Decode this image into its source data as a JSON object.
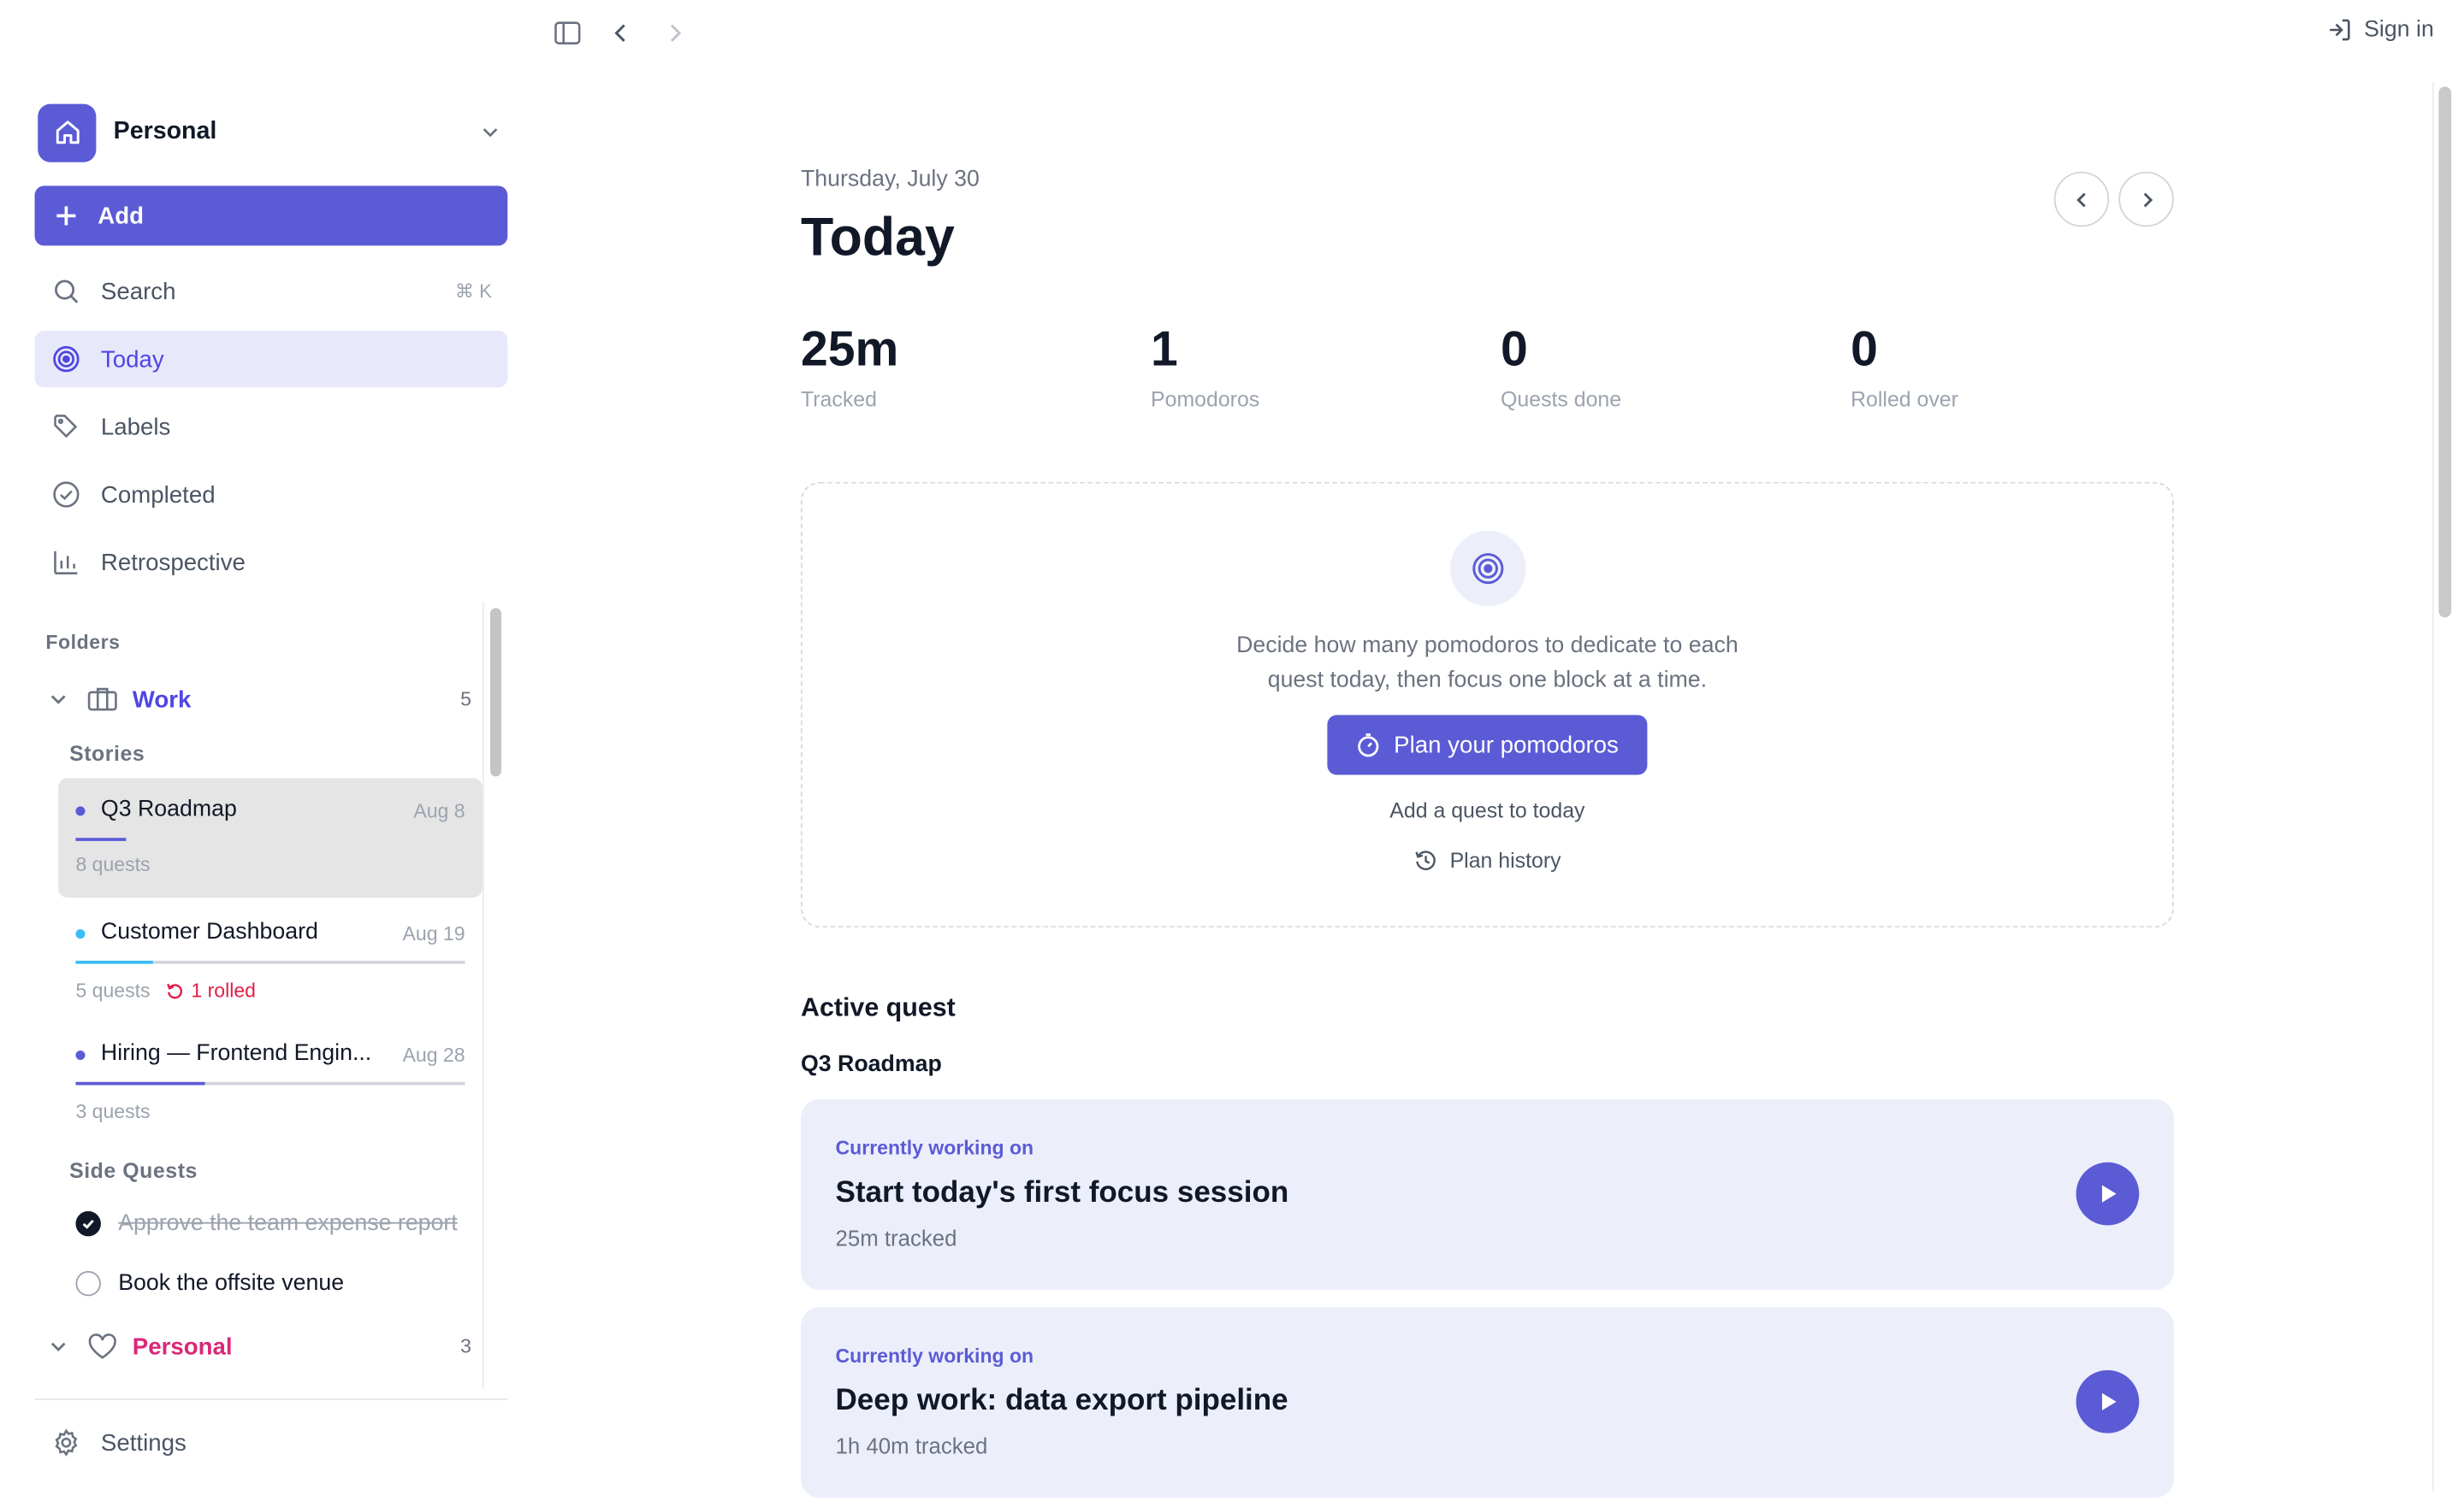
{
  "app": {
    "sign_in_label": "Sign in"
  },
  "colors": {
    "accent": "#5b5bd6",
    "work_folder": "#4f46e5",
    "personal_folder": "#db2777",
    "rolled": "#e11d48"
  },
  "sidebar": {
    "workspace": {
      "name": "Personal",
      "icon": "home-icon"
    },
    "add_label": "Add",
    "nav": [
      {
        "label": "Search",
        "icon": "search-icon",
        "shortcut": "⌘ K"
      },
      {
        "label": "Today",
        "icon": "target-icon",
        "active": true
      },
      {
        "label": "Labels",
        "icon": "tag-icon"
      },
      {
        "label": "Completed",
        "icon": "check-circle-icon"
      },
      {
        "label": "Retrospective",
        "icon": "bar-chart-icon"
      }
    ],
    "folders_label": "Folders",
    "folders": [
      {
        "name": "Work",
        "count": "5",
        "icon": "briefcase-icon",
        "stories_label": "Stories",
        "stories": [
          {
            "title": "Q3 Roadmap",
            "date": "Aug 8",
            "meta": "8 quests",
            "progress": 0.13,
            "color": "#5b5bd6"
          },
          {
            "title": "Customer Dashboard",
            "date": "Aug 19",
            "meta": "5 quests",
            "rolled": "1 rolled",
            "progress": 0.2,
            "color": "#38bdf8"
          },
          {
            "title": "Hiring — Frontend Engin...",
            "date": "Aug 28",
            "meta": "3 quests",
            "progress": 0.33,
            "color": "#5b5bd6"
          }
        ],
        "side_quests_label": "Side Quests",
        "side_quests": [
          {
            "label": "Approve the team expense report",
            "done": true
          },
          {
            "label": "Book the offsite venue",
            "done": false
          }
        ]
      },
      {
        "name": "Personal",
        "count": "3",
        "icon": "heart-icon"
      }
    ],
    "settings_label": "Settings"
  },
  "main": {
    "date": "Thursday, July 30",
    "title": "Today",
    "stats": [
      {
        "value": "25m",
        "label": "Tracked"
      },
      {
        "value": "1",
        "label": "Pomodoros"
      },
      {
        "value": "0",
        "label": "Quests done"
      },
      {
        "value": "0",
        "label": "Rolled over"
      }
    ],
    "plan": {
      "text_line1": "Decide how many pomodoros to dedicate to each",
      "text_line2": "quest today, then focus one block at a time.",
      "button": "Plan your pomodoros",
      "add_link": "Add a quest to today",
      "history_link": "Plan history"
    },
    "active_quest_heading": "Active quest",
    "active_story": "Q3 Roadmap",
    "quests": [
      {
        "kicker": "Currently working on",
        "title": "Start today's first focus session",
        "meta": "25m tracked"
      },
      {
        "kicker": "Currently working on",
        "title": "Deep work: data export pipeline",
        "meta": "1h 40m tracked"
      }
    ]
  }
}
